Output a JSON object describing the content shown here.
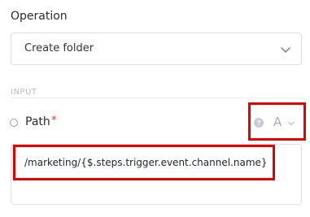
{
  "operation": {
    "label": "Operation",
    "selected_value": "Create folder"
  },
  "input_section": {
    "label": "INPUT"
  },
  "path_param": {
    "name": "Path",
    "required_marker": "*",
    "mode_letter": "A",
    "value": "/marketing/{$.steps.trigger.event.channel.name}"
  },
  "colors": {
    "highlight_border": "#e60000",
    "required": "#e53935"
  },
  "icons": {
    "select_chevron": "chevron-down-icon",
    "help": "help-icon",
    "mode_chevron": "chevron-down-icon"
  }
}
